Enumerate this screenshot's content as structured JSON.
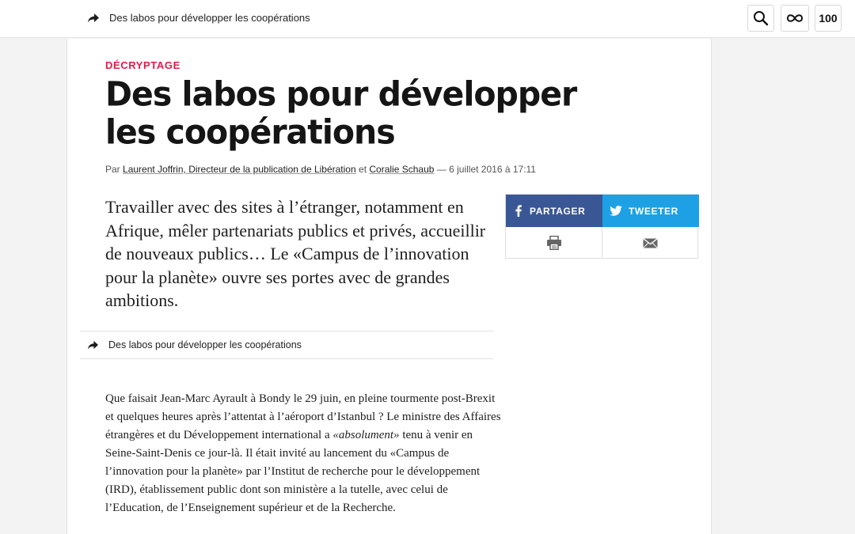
{
  "topbar": {
    "title": "Des labos pour développer les coopérations",
    "hundred_label": "100"
  },
  "article": {
    "kicker": "Décryptage",
    "headline": "Des labos pour développer les coopérations",
    "byline": {
      "prefix": "Par",
      "author1": "Laurent Joffrin, Directeur de la publication de Libération",
      "conj": "et",
      "author2": "Coralie Schaub",
      "date": "— 6 juillet 2016 à 17:11"
    },
    "lede": "Travailler avec des sites à l’étranger, notamment en Afrique, mêler partenariats publics et privés, accueillir de nouveaux publics… Le «Campus de l’innovation pour la planète» ouvre ses portes avec de grandes ambitions.",
    "share": {
      "facebook_label": "PARTAGER",
      "twitter_label": "TWEETER"
    },
    "inline_share_title": "Des labos pour développer les coopérations",
    "body": {
      "part1": "Que faisait Jean-Marc Ayrault à Bondy le 29 juin, en pleine tourmente post-Brexit et quelques heures après l’attentat à l’aéroport d’Istanbul ? Le ministre des Affaires étrangères et du Développement international a ",
      "emph": "«absolument»",
      "part2": " tenu à venir en Seine-Saint-Denis ce jour-là. Il était invité au lancement du «Campus de l’innovation pour la planète» par l’Institut de recherche pour le développement (IRD), établissement public dont son ministère a la tutelle, avec celui de l’Education, de l’Enseignement supérieur et de la Recherche."
    }
  },
  "colors": {
    "kicker": "#e6194b",
    "facebook": "#3a5795",
    "twitter": "#1da1e4"
  }
}
